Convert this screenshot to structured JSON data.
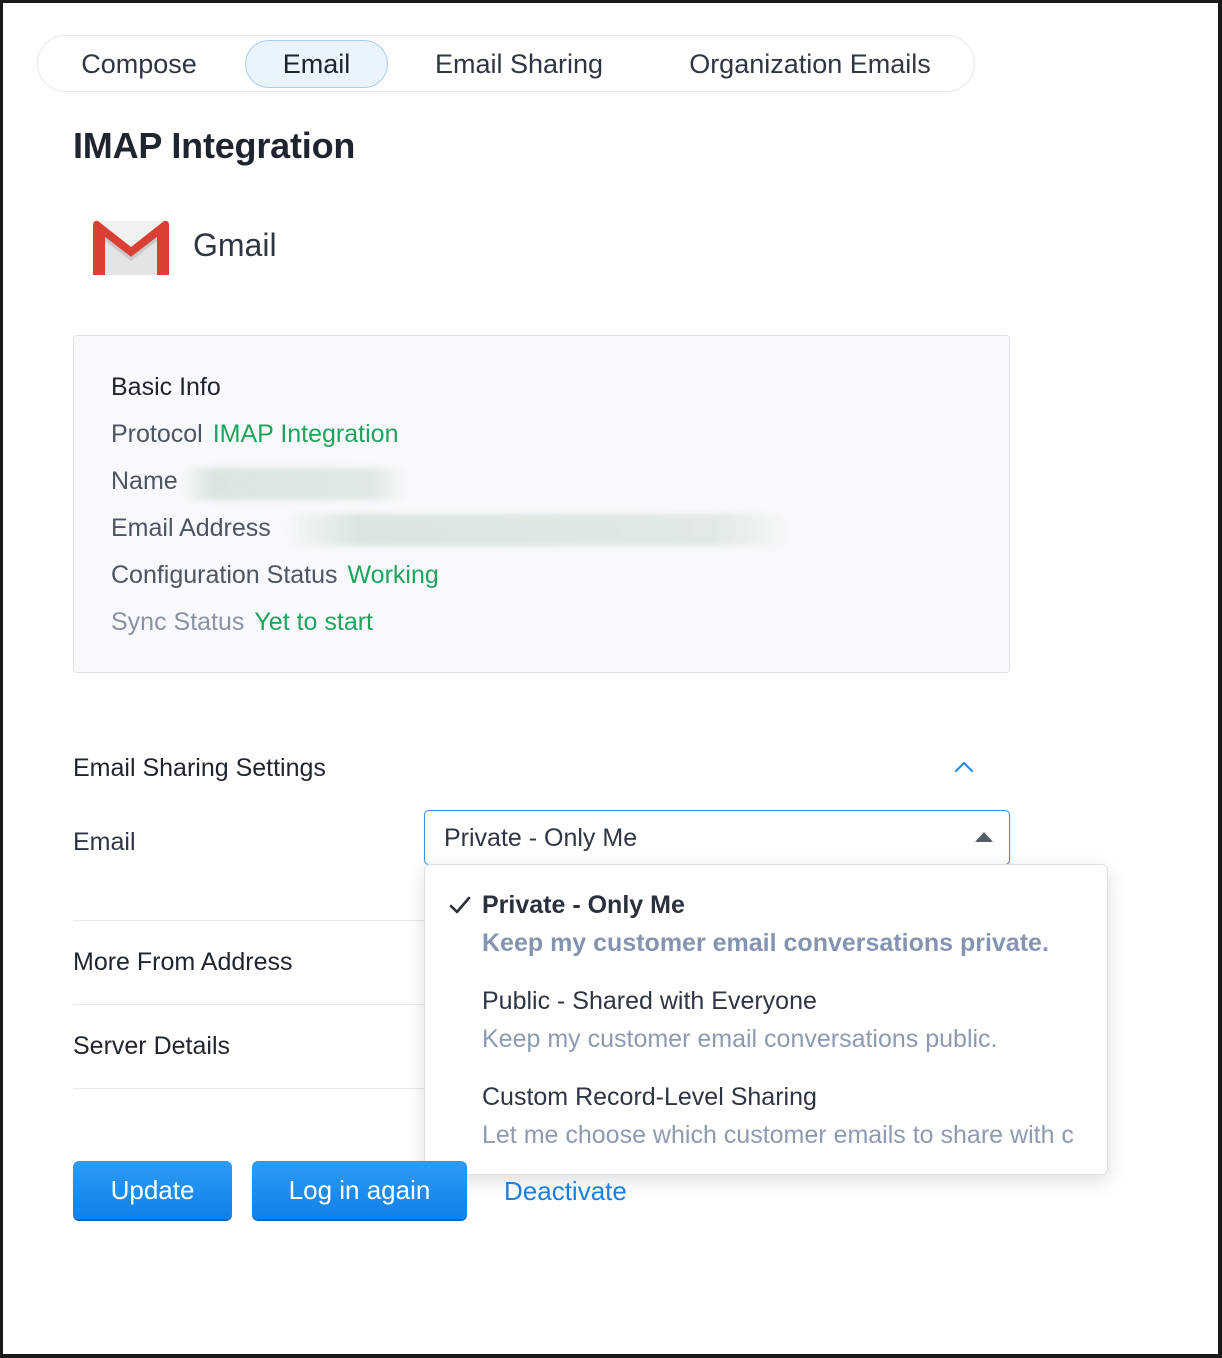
{
  "tabs": [
    {
      "label": "Compose",
      "active": false
    },
    {
      "label": "Email",
      "active": true
    },
    {
      "label": "Email Sharing",
      "active": false
    },
    {
      "label": "Organization Emails",
      "active": false
    }
  ],
  "page": {
    "title": "IMAP Integration"
  },
  "provider": {
    "name": "Gmail",
    "icon": "gmail-icon"
  },
  "basic_info": {
    "title": "Basic Info",
    "protocol_label": "Protocol",
    "protocol_value": "IMAP Integration",
    "name_label": "Name",
    "email_label": "Email Address",
    "config_label": "Configuration Status",
    "config_value": "Working",
    "sync_label": "Sync Status",
    "sync_value": "Yet to start"
  },
  "sharing": {
    "title": "Email Sharing Settings",
    "email_label": "Email",
    "selected": "Private - Only Me",
    "options": [
      {
        "title": "Private - Only Me",
        "desc": "Keep my customer email conversations private.",
        "selected": true
      },
      {
        "title": "Public - Shared with Everyone",
        "desc": "Keep my customer email conversations public.",
        "selected": false
      },
      {
        "title": "Custom Record-Level Sharing",
        "desc": "Let me choose which customer emails to share with c",
        "selected": false
      }
    ]
  },
  "sections": {
    "more_from": "More From Address",
    "server": "Server Details"
  },
  "actions": {
    "update": "Update",
    "login_again": "Log in again",
    "deactivate": "Deactivate"
  },
  "colors": {
    "accent": "#1a7fe0",
    "success": "#1ea45c",
    "button": "#1180ea"
  }
}
